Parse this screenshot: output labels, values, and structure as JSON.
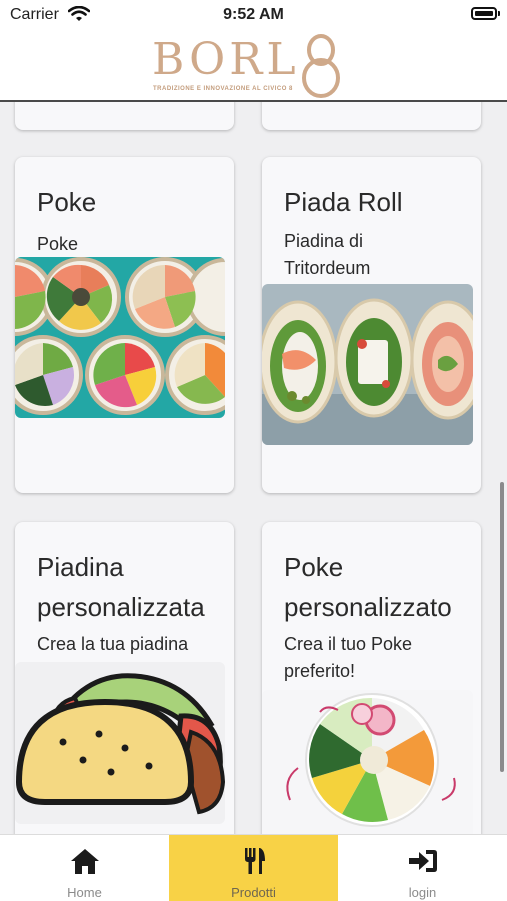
{
  "status_bar": {
    "carrier": "Carrier",
    "time": "9:52 AM"
  },
  "header": {
    "logo_text": "BORL",
    "logo_tagline": "TRADIZIONE E INNOVAZIONE AL CIVICO 8"
  },
  "products": [
    {
      "title": "Poke",
      "description": "Poke",
      "image": "poke-bowls-photo"
    },
    {
      "title": "Piada Roll",
      "description": "Piadina di Tritordeum",
      "image": "piada-roll-photo"
    },
    {
      "title": "Piadina personalizzata",
      "description": "Crea la tua piadina",
      "image": "taco-illustration"
    },
    {
      "title": "Poke personalizzato",
      "description": "Crea il tuo Poke preferito!",
      "image": "custom-poke-photo"
    }
  ],
  "tabs": [
    {
      "label": "Home",
      "icon": "home-icon",
      "active": false
    },
    {
      "label": "Prodotti",
      "icon": "fork-knife-icon",
      "active": true
    },
    {
      "label": "login",
      "icon": "sign-in-icon",
      "active": false
    }
  ],
  "colors": {
    "accent": "#f8d246",
    "logo": "#cfa98a",
    "background": "#efeff1"
  }
}
